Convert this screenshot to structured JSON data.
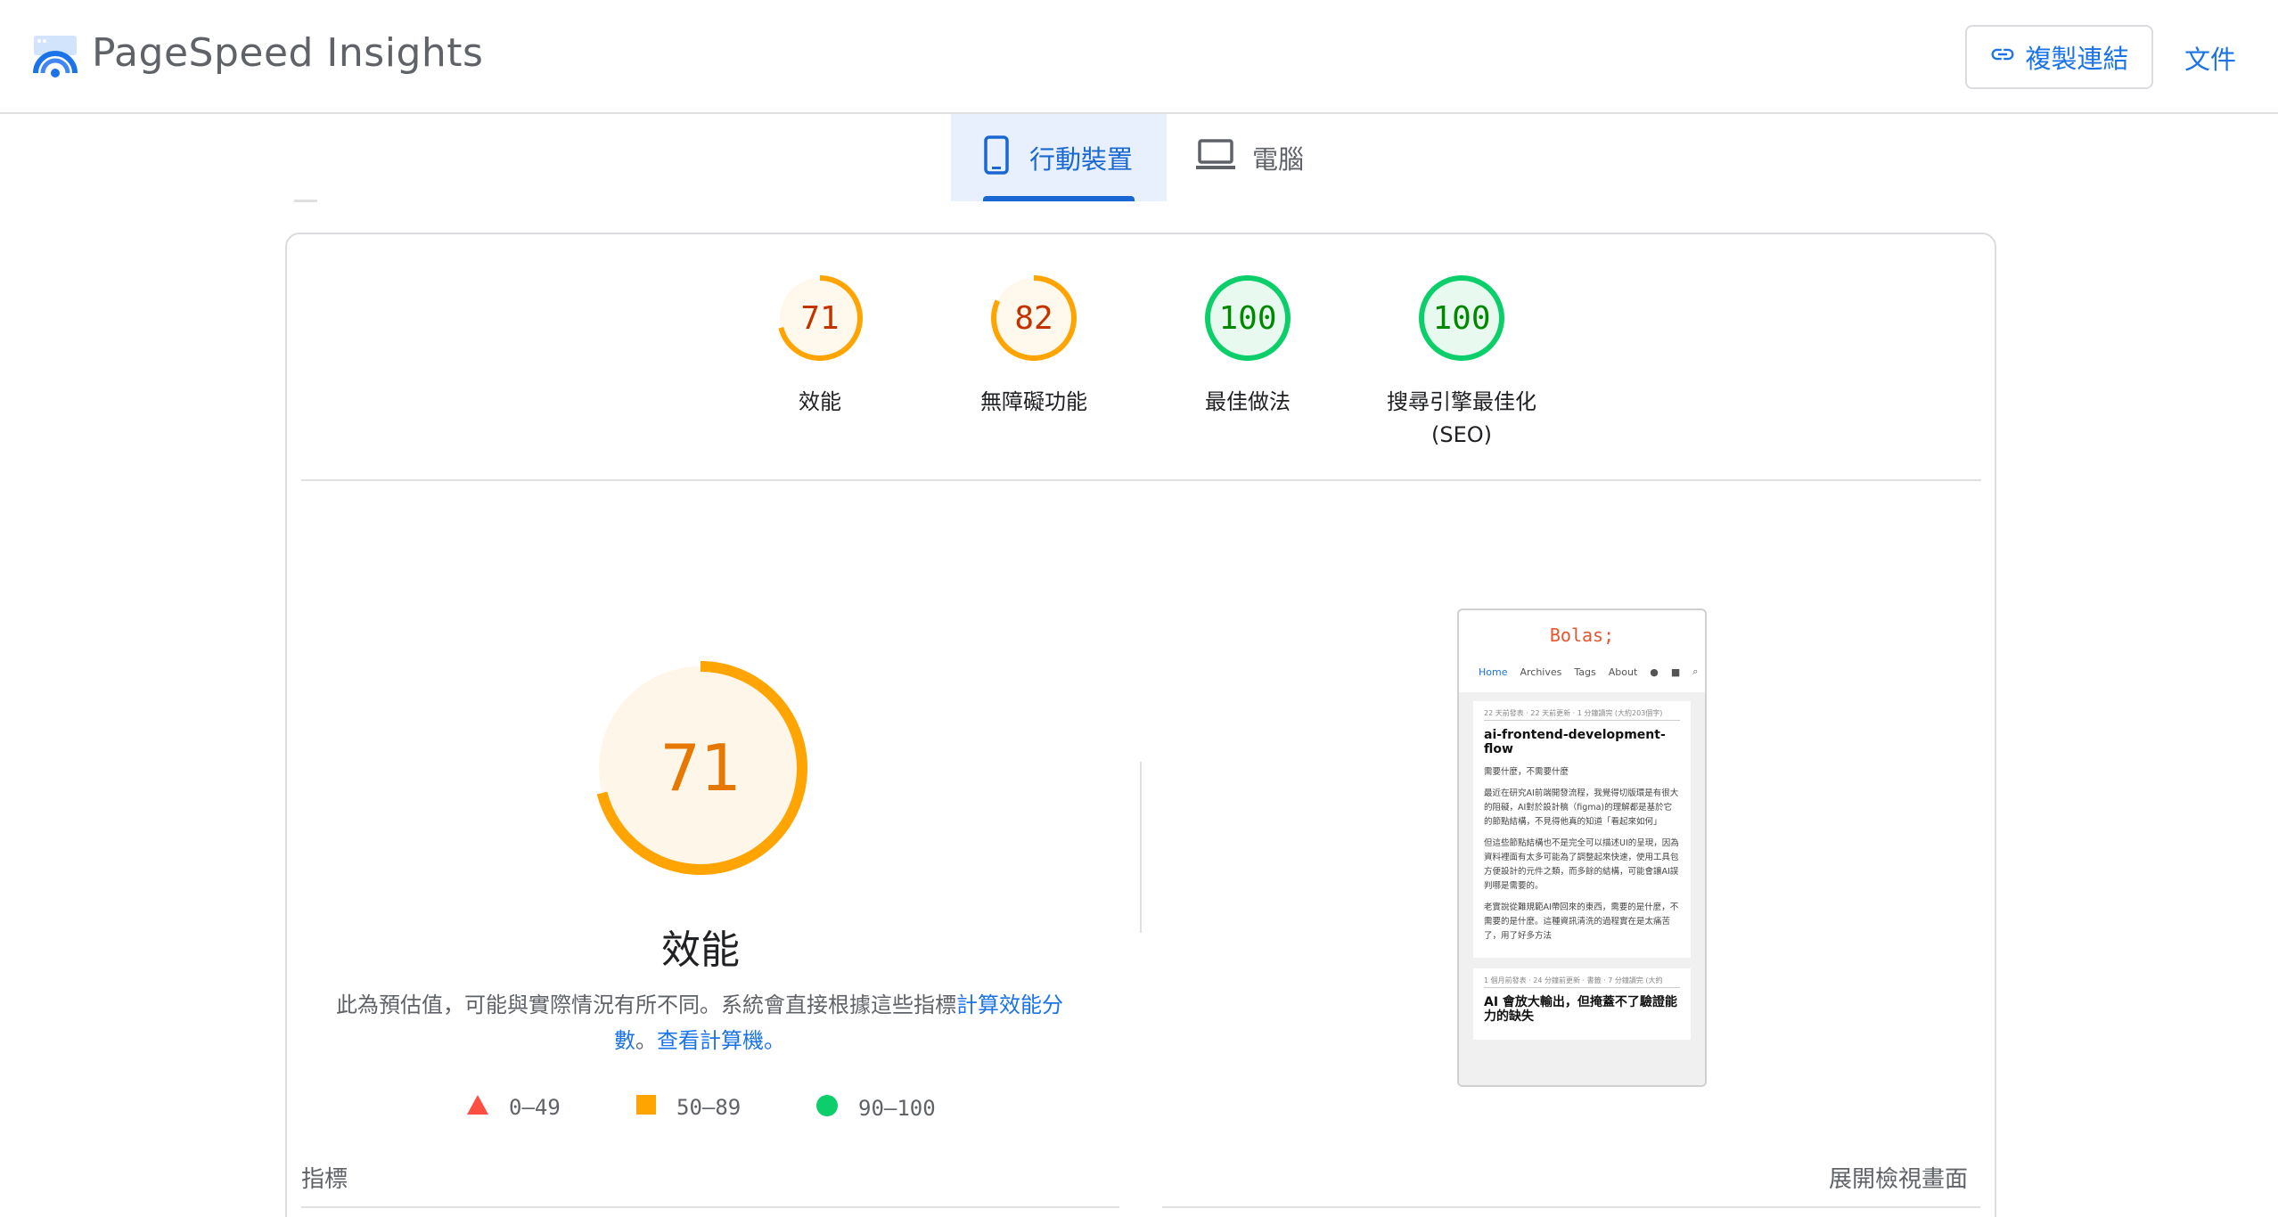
{
  "header": {
    "app_title": "PageSpeed Insights",
    "copy_link_label": "複製連結",
    "docs_label": "文件"
  },
  "tabs": [
    {
      "label": "行動裝置",
      "active": true
    },
    {
      "label": "電腦",
      "active": false
    }
  ],
  "colors": {
    "accent": "#1a73e8",
    "average": "#ffa400",
    "average_text": "#c33300",
    "pass": "#0cce6b",
    "pass_text": "#008800",
    "fail": "#ff4e42"
  },
  "scores": [
    {
      "value": "71",
      "label": "效能",
      "status": "average"
    },
    {
      "value": "82",
      "label": "無障礙功能",
      "status": "average"
    },
    {
      "value": "100",
      "label": "最佳做法",
      "status": "pass"
    },
    {
      "value": "100",
      "label": "搜尋引擎最佳化",
      "label2": "(SEO)",
      "status": "pass"
    }
  ],
  "performance": {
    "score": "71",
    "title": "效能",
    "desc_text": "此為預估值，可能與實際情況有所不同。系統會直接根據這些指標",
    "desc_link": "計算效能分數",
    "desc_sep": "。",
    "calc_link": "查看計算機",
    "desc_end": "。"
  },
  "legend": [
    {
      "range": "0–49",
      "shape": "triangle"
    },
    {
      "range": "50–89",
      "shape": "square"
    },
    {
      "range": "90–100",
      "shape": "circle"
    }
  ],
  "metrics_title": "指標",
  "expand_view": "展開檢視畫面",
  "preview": {
    "logo": "Bolas;",
    "nav": [
      "Home",
      "Archives",
      "Tags",
      "About"
    ],
    "post1": {
      "meta": "22 天前發表 · 22 天前更新 · 1 分鐘讀完 (大約203個字)",
      "title": "ai-frontend-development-flow",
      "p1": "需要什麼，不需要什麼",
      "p2": "最近在研究AI前端開發流程，我覺得切版環是有很大的阻礙，AI對於設計稿（figma)的理解都是基於它的節點結構，不見得他真的知道「看起來如何」",
      "p3": "但這些節點結構也不是完全可以描述UI的呈現，因為資料裡面有太多可能為了調整起來快速，使用工具包方便設計的元件之類，而多餘的結構，可能會讓AI誤判哪是需要的。",
      "p4": "老實說從難規範AI帶回來的東西，需要的是什麼，不需要的是什麼。這種資訊清洗的過程實在是太痛苦了，用了好多方法"
    },
    "post2": {
      "meta": "1 個月前發表 · 24 分鐘前更新 · 書籤 · 7 分鐘讀完 (大約",
      "title": "AI 會放大輸出，但掩蓋不了驗證能力的缺失"
    }
  }
}
